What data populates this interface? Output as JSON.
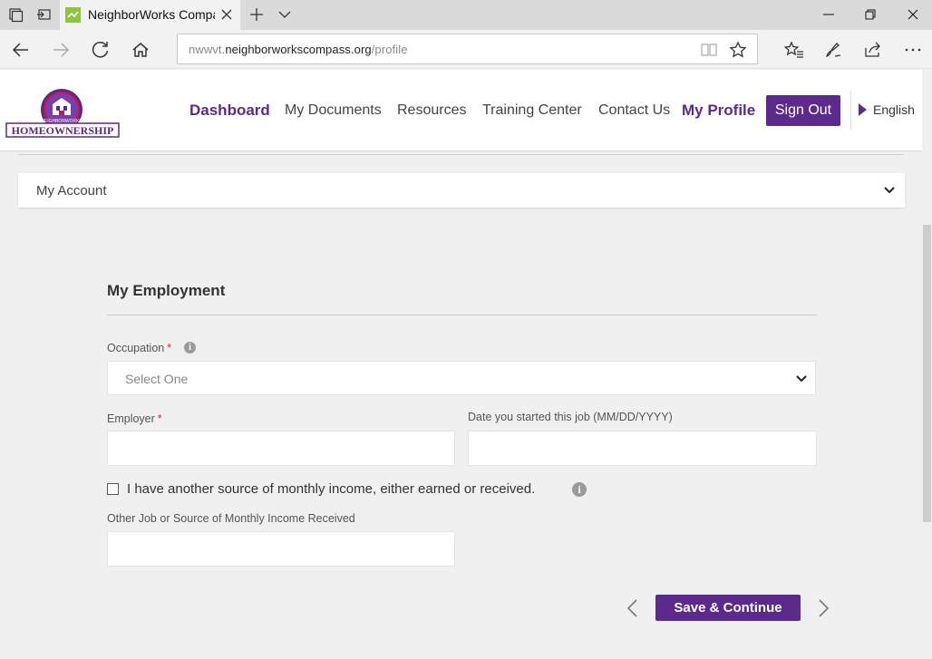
{
  "browser": {
    "tab_title": "NeighborWorks Compa",
    "url_prefix": "nwwvt.",
    "url_domain": "neighborworkscompass.org",
    "url_path": "/profile"
  },
  "site": {
    "logo_top_text": "NEIGHBORWORKS",
    "logo_text": "HOMEOWNERSHIP",
    "nav": [
      "Dashboard",
      "My Documents",
      "Resources",
      "Training Center",
      "Contact Us",
      "My Profile"
    ],
    "signout": "Sign Out",
    "language": "English",
    "accent_color": "#5c2a8c"
  },
  "account": {
    "title": "My Account"
  },
  "employment": {
    "title": "My Employment",
    "occupation_label": "Occupation",
    "occupation_value": "Select One",
    "employer_label": "Employer",
    "employer_value": "",
    "start_date_label": "Date you started this job (MM/DD/YYYY)",
    "start_date_value": "",
    "other_income_checkbox": "I have another source of monthly income, either earned or received.",
    "other_income_checked": false,
    "other_job_label": "Other Job or Source of Monthly Income Received",
    "other_job_value": "",
    "required_mark": "*",
    "info_glyph": "i"
  },
  "actions": {
    "save": "Save & Continue"
  }
}
